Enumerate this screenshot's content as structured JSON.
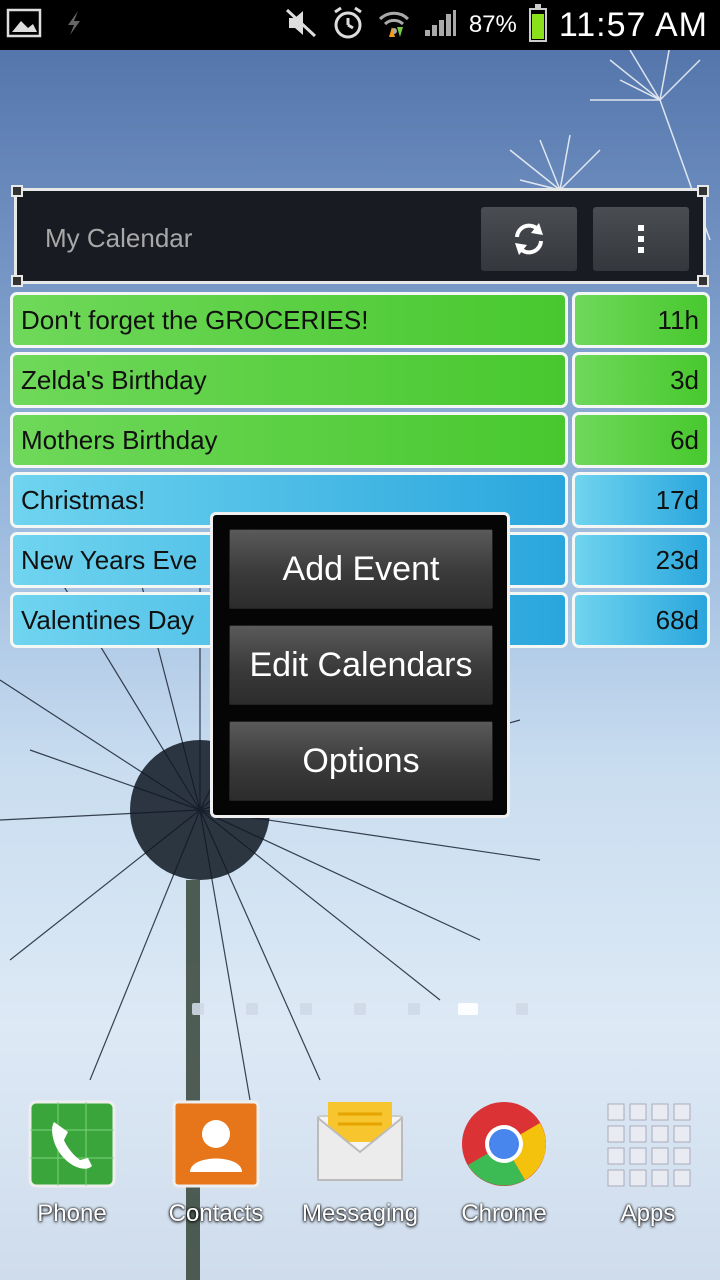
{
  "status_bar": {
    "battery_pct": "87%",
    "time": "11:57 AM",
    "icons": [
      "image-icon",
      "flash-icon",
      "mute-icon",
      "alarm-icon",
      "wifi-icon",
      "signal-icon",
      "battery-icon"
    ]
  },
  "widget": {
    "title": "My Calendar",
    "refresh_icon": "refresh-icon",
    "menu_icon": "overflow-menu-icon",
    "events": [
      {
        "name": "Don't forget the GROCERIES!",
        "time": "11h",
        "color": "green"
      },
      {
        "name": "Zelda's Birthday",
        "time": "3d",
        "color": "green"
      },
      {
        "name": "Mothers Birthday",
        "time": "6d",
        "color": "green"
      },
      {
        "name": "Christmas!",
        "time": "17d",
        "color": "blue"
      },
      {
        "name": "New Years Eve",
        "time": "23d",
        "color": "blue"
      },
      {
        "name": "Valentines Day",
        "time": "68d",
        "color": "blue"
      }
    ]
  },
  "popup_menu": {
    "items": [
      "Add Event",
      "Edit Calendars",
      "Options"
    ]
  },
  "home_pages": {
    "count": 7,
    "active_index": 5
  },
  "dock": [
    {
      "label": "Phone",
      "icon": "phone-icon"
    },
    {
      "label": "Contacts",
      "icon": "contacts-icon"
    },
    {
      "label": "Messaging",
      "icon": "messaging-icon"
    },
    {
      "label": "Chrome",
      "icon": "chrome-icon"
    },
    {
      "label": "Apps",
      "icon": "apps-grid-icon"
    }
  ],
  "colors": {
    "event_green": "#48c82e",
    "event_blue": "#2aa6dd",
    "battery_fill": "#8be01c"
  }
}
